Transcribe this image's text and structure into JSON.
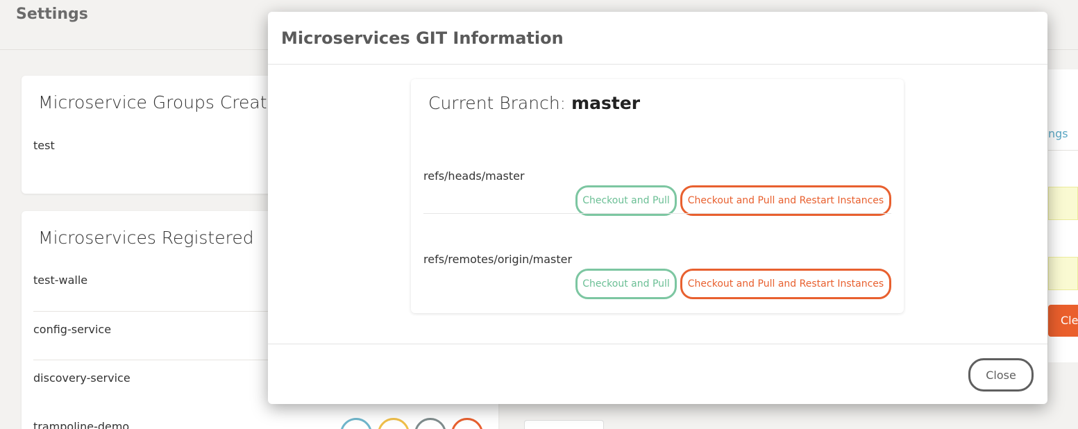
{
  "page": {
    "title": "Settings"
  },
  "groups_card": {
    "title": "Microservice Groups Created",
    "items": [
      "test"
    ]
  },
  "microservices_card": {
    "title": "Microservices Registered",
    "items": [
      "test-walle",
      "config-service",
      "discovery-service",
      "trampoline-demo"
    ]
  },
  "right_panel": {
    "link_fragment": "ngs",
    "button_fragment": "Cle"
  },
  "modal": {
    "title": "Microservices GIT Information",
    "current_branch_label": "Current Branch:",
    "current_branch": "master",
    "refs": [
      {
        "name": "refs/heads/master",
        "pull_label": "Checkout and Pull",
        "restart_label": "Checkout and Pull and Restart Instances"
      },
      {
        "name": "refs/remotes/origin/master",
        "pull_label": "Checkout and Pull",
        "restart_label": "Checkout and Pull and Restart Instances"
      }
    ],
    "close_label": "Close"
  },
  "colors": {
    "pull_green": "#6bbf95",
    "restart_orange": "#e8602f",
    "circle_blue": "#6fb6cc",
    "circle_yellow": "#f0bf4a",
    "circle_grey": "#7f8c8d",
    "circle_orange": "#e8602f"
  }
}
